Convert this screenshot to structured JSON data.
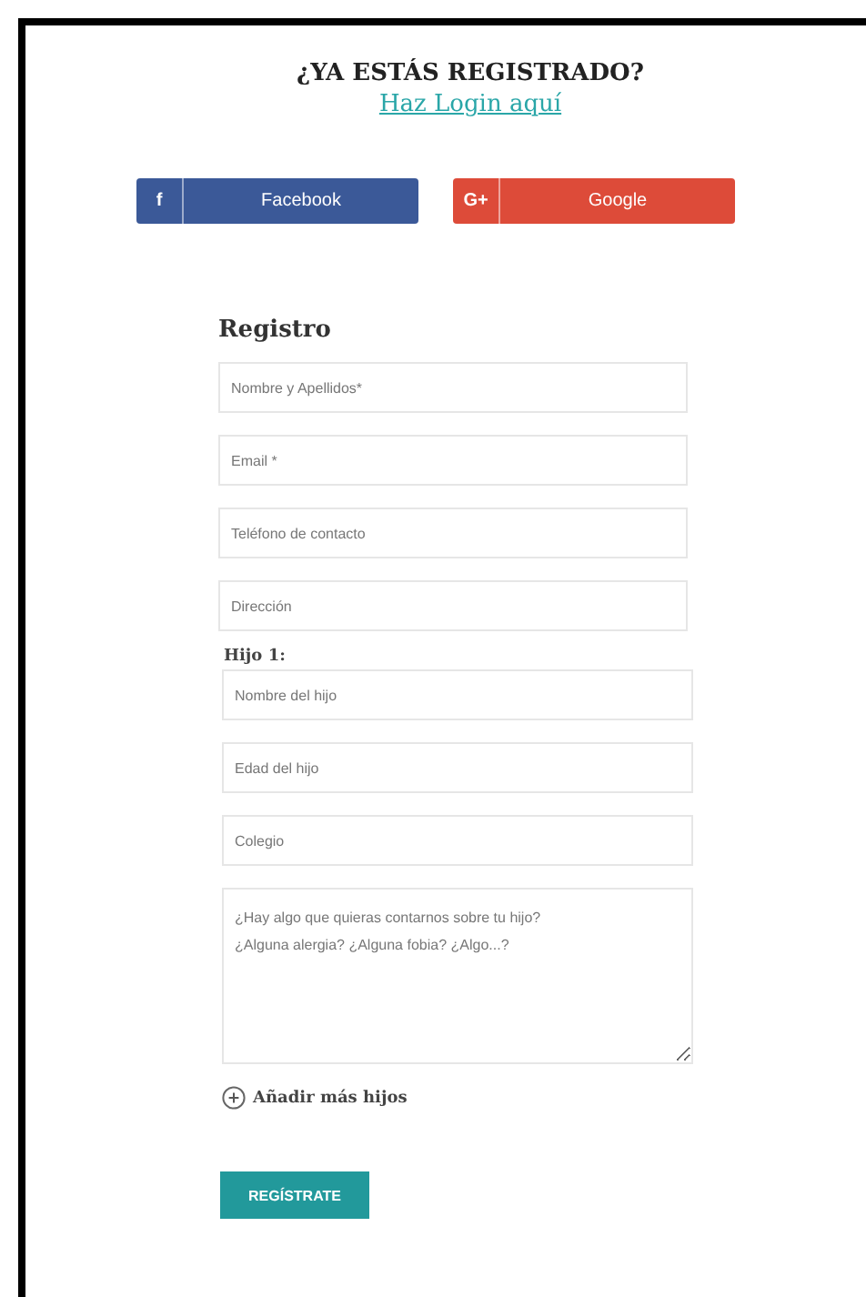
{
  "header": {
    "title": "¿YA ESTÁS REGISTRADO?",
    "login_link": "Haz Login aquí"
  },
  "social_buttons": [
    {
      "kind": "facebook",
      "icon": "f",
      "label": "Facebook"
    },
    {
      "kind": "google",
      "icon": "G+",
      "label": "Google"
    }
  ],
  "form": {
    "title": "Registro",
    "fields": [
      {
        "placeholder": "Nombre y Apellidos*"
      },
      {
        "placeholder": "Email *"
      },
      {
        "placeholder": "Teléfono de contacto"
      },
      {
        "placeholder": "Dirección"
      }
    ],
    "child": {
      "title": "Hijo 1:",
      "fields": [
        {
          "placeholder": "Nombre del hijo"
        },
        {
          "placeholder": "Edad del hijo"
        },
        {
          "placeholder": "Colegio"
        }
      ],
      "notes": {
        "placeholder": "¿Hay algo que quieras contarnos sobre tu hijo?\n¿Alguna alergia? ¿Alguna fobia? ¿Algo...?"
      }
    },
    "add_child": "Añadir más hijos",
    "submit": "REGÍSTRATE"
  }
}
